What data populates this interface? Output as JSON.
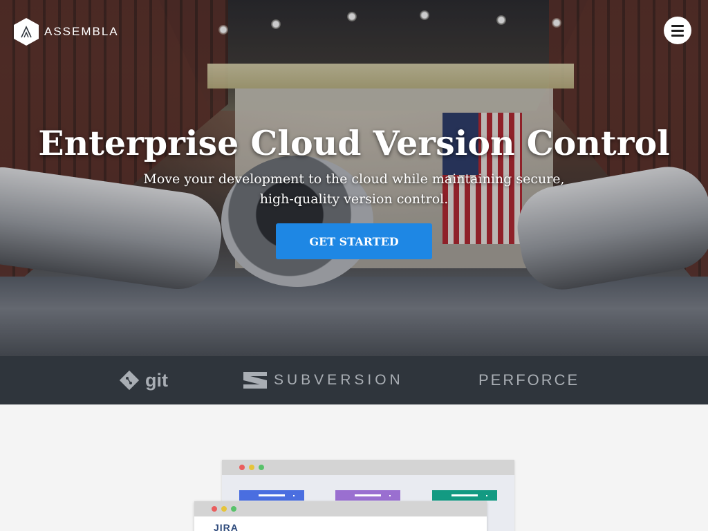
{
  "header": {
    "logo_text": "ASSEMBLA",
    "menu_icon": "hamburger-icon"
  },
  "hero": {
    "title": "Enterprise Cloud Version Control",
    "subtitle": "Move your development to the cloud while maintaining secure, high-quality version control.",
    "cta_label": "GET STARTED"
  },
  "vcs": {
    "items": [
      {
        "label": "git",
        "icon": "git-icon"
      },
      {
        "label": "SUBVERSION",
        "icon": "subversion-icon"
      },
      {
        "label": "PERFORCE",
        "icon": "perforce-logo"
      }
    ]
  },
  "illustration": {
    "jira_label": "JIRA"
  },
  "colors": {
    "accent": "#1e87e4",
    "vcs_bar": "#2f353c",
    "card_blue": "#4a6ee0",
    "card_purple": "#9a6fd0",
    "card_teal": "#139a82"
  }
}
